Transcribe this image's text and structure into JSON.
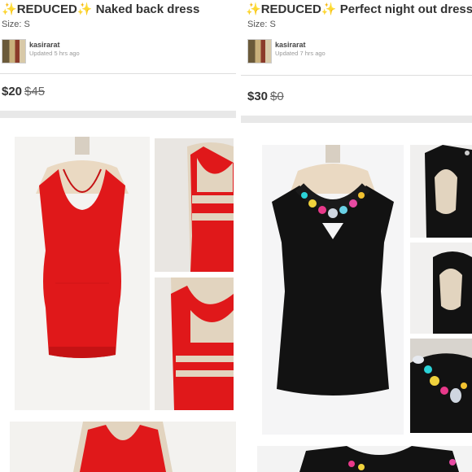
{
  "listings": [
    {
      "spark": "✨",
      "badge": "REDUCED",
      "name": "Naked back dress",
      "size": "Size: S",
      "seller": "kasirarat",
      "updated": "Updated 5 hrs ago",
      "price": "$20",
      "original_price": "$45",
      "dress_color": "#e0181a",
      "photos": [
        "front-view",
        "back-view-top",
        "back-view-straps",
        "front-view-partial"
      ]
    },
    {
      "spark": "✨",
      "badge": "REDUCED",
      "name": "Perfect night out dress",
      "size": "Size: S",
      "seller": "kasirarat",
      "updated": "Updated 7 hrs ago",
      "price": "$30",
      "original_price": "$0",
      "dress_color": "#111111",
      "photos": [
        "front-view",
        "back-view-top",
        "back-view-cutout",
        "jeweled-neckline-detail",
        "front-view-partial"
      ]
    }
  ]
}
